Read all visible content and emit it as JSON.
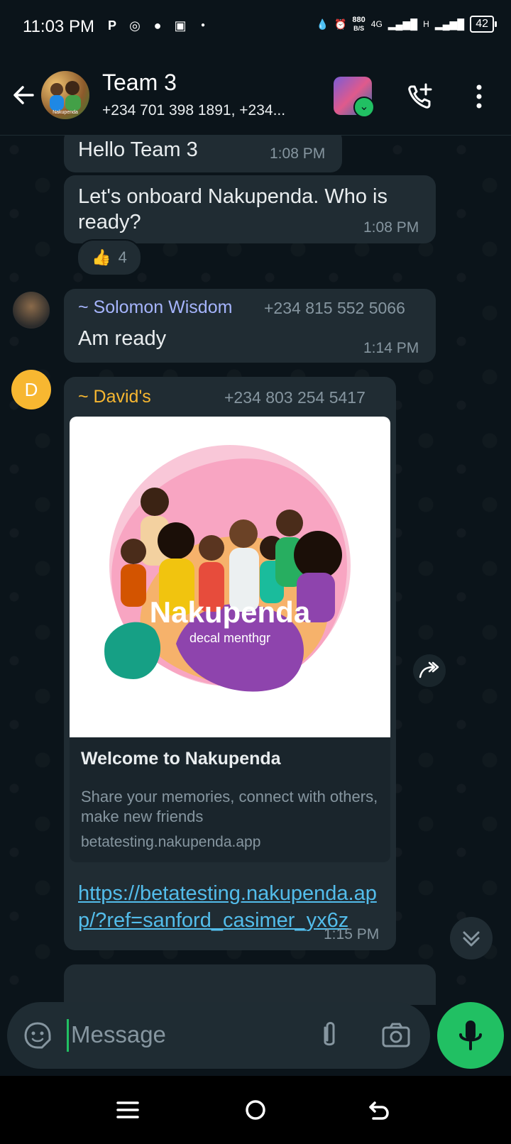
{
  "status": {
    "time": "11:03 PM",
    "net_speed_top": "880",
    "net_speed_unit": "B/S",
    "network": "4G",
    "network2": "H",
    "battery": "42"
  },
  "header": {
    "title": "Team 3",
    "subtitle": "+234 701 398 1891, +234...",
    "avatar_label": "Nakupenda"
  },
  "messages": [
    {
      "text": "Hello Team 3",
      "time": "1:08 PM"
    },
    {
      "text": "Let's onboard Nakupenda. Who is ready?",
      "time": "1:08 PM",
      "reaction_emoji": "👍",
      "reaction_count": "4"
    },
    {
      "sender": "~ Solomon Wisdom",
      "phone": "+234 815 552 5066",
      "text": "Am ready",
      "time": "1:14 PM",
      "sender_color": "#a5b4fc"
    },
    {
      "sender": "~ David's",
      "avatar_letter": "D",
      "phone": "+234 803 254 5417",
      "sender_color": "#f7b731",
      "link_preview": {
        "image_title": "Nakupenda",
        "image_subtitle": "decal menthgr",
        "title": "Welcome to Nakupenda",
        "description": "Share your memories, connect with others, make new friends",
        "domain": "betatesting.nakupenda.app"
      },
      "link": "https://betatesting.nakupenda.app/?ref=sanford_casimer_yx6z",
      "time": "1:15 PM"
    }
  ],
  "input": {
    "placeholder": "Message"
  },
  "colors": {
    "accent": "#21c063",
    "bubble": "#202c33",
    "background": "#0b141a",
    "link": "#53bdeb"
  }
}
